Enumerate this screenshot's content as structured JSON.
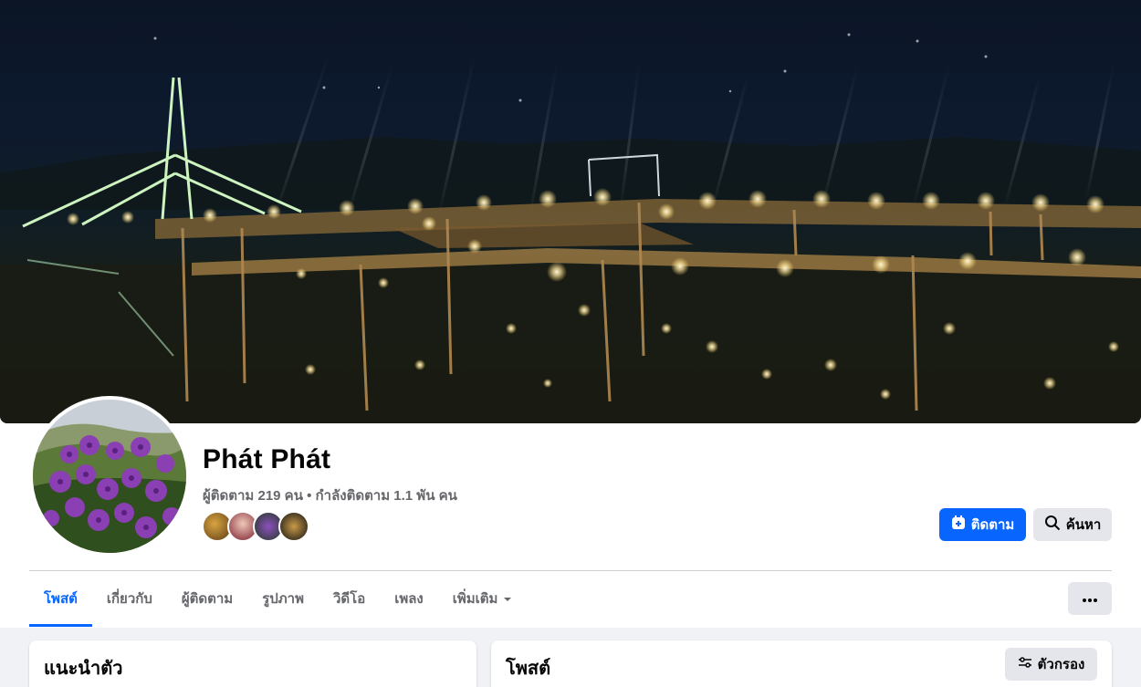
{
  "profile": {
    "name": "Phát Phát",
    "stats": "ผู้ติดตาม 219 คน • กำลังติดตาม 1.1 พัน คน"
  },
  "actions": {
    "follow_label": "ติดตาม",
    "search_label": "ค้นหา"
  },
  "tabs": [
    {
      "label": "โพสต์",
      "active": true
    },
    {
      "label": "เกี่ยวกับ"
    },
    {
      "label": "ผู้ติดตาม"
    },
    {
      "label": "รูปภาพ"
    },
    {
      "label": "วิดีโอ"
    },
    {
      "label": "เพลง"
    },
    {
      "label": "เพิ่มเติม"
    }
  ],
  "intro": {
    "title": "แนะนำตัว"
  },
  "posts": {
    "title": "โพสต์",
    "filter_label": "ตัวกรอง"
  },
  "colors": {
    "accent": "#0866ff",
    "secondary_button": "#e4e6eb",
    "muted_text": "#65676b"
  },
  "icons": {
    "follow": "add-follow-icon",
    "search": "search-icon",
    "more_tab": "caret-down-icon",
    "more_actions": "ellipsis-icon",
    "filter": "filter-sliders-icon"
  }
}
